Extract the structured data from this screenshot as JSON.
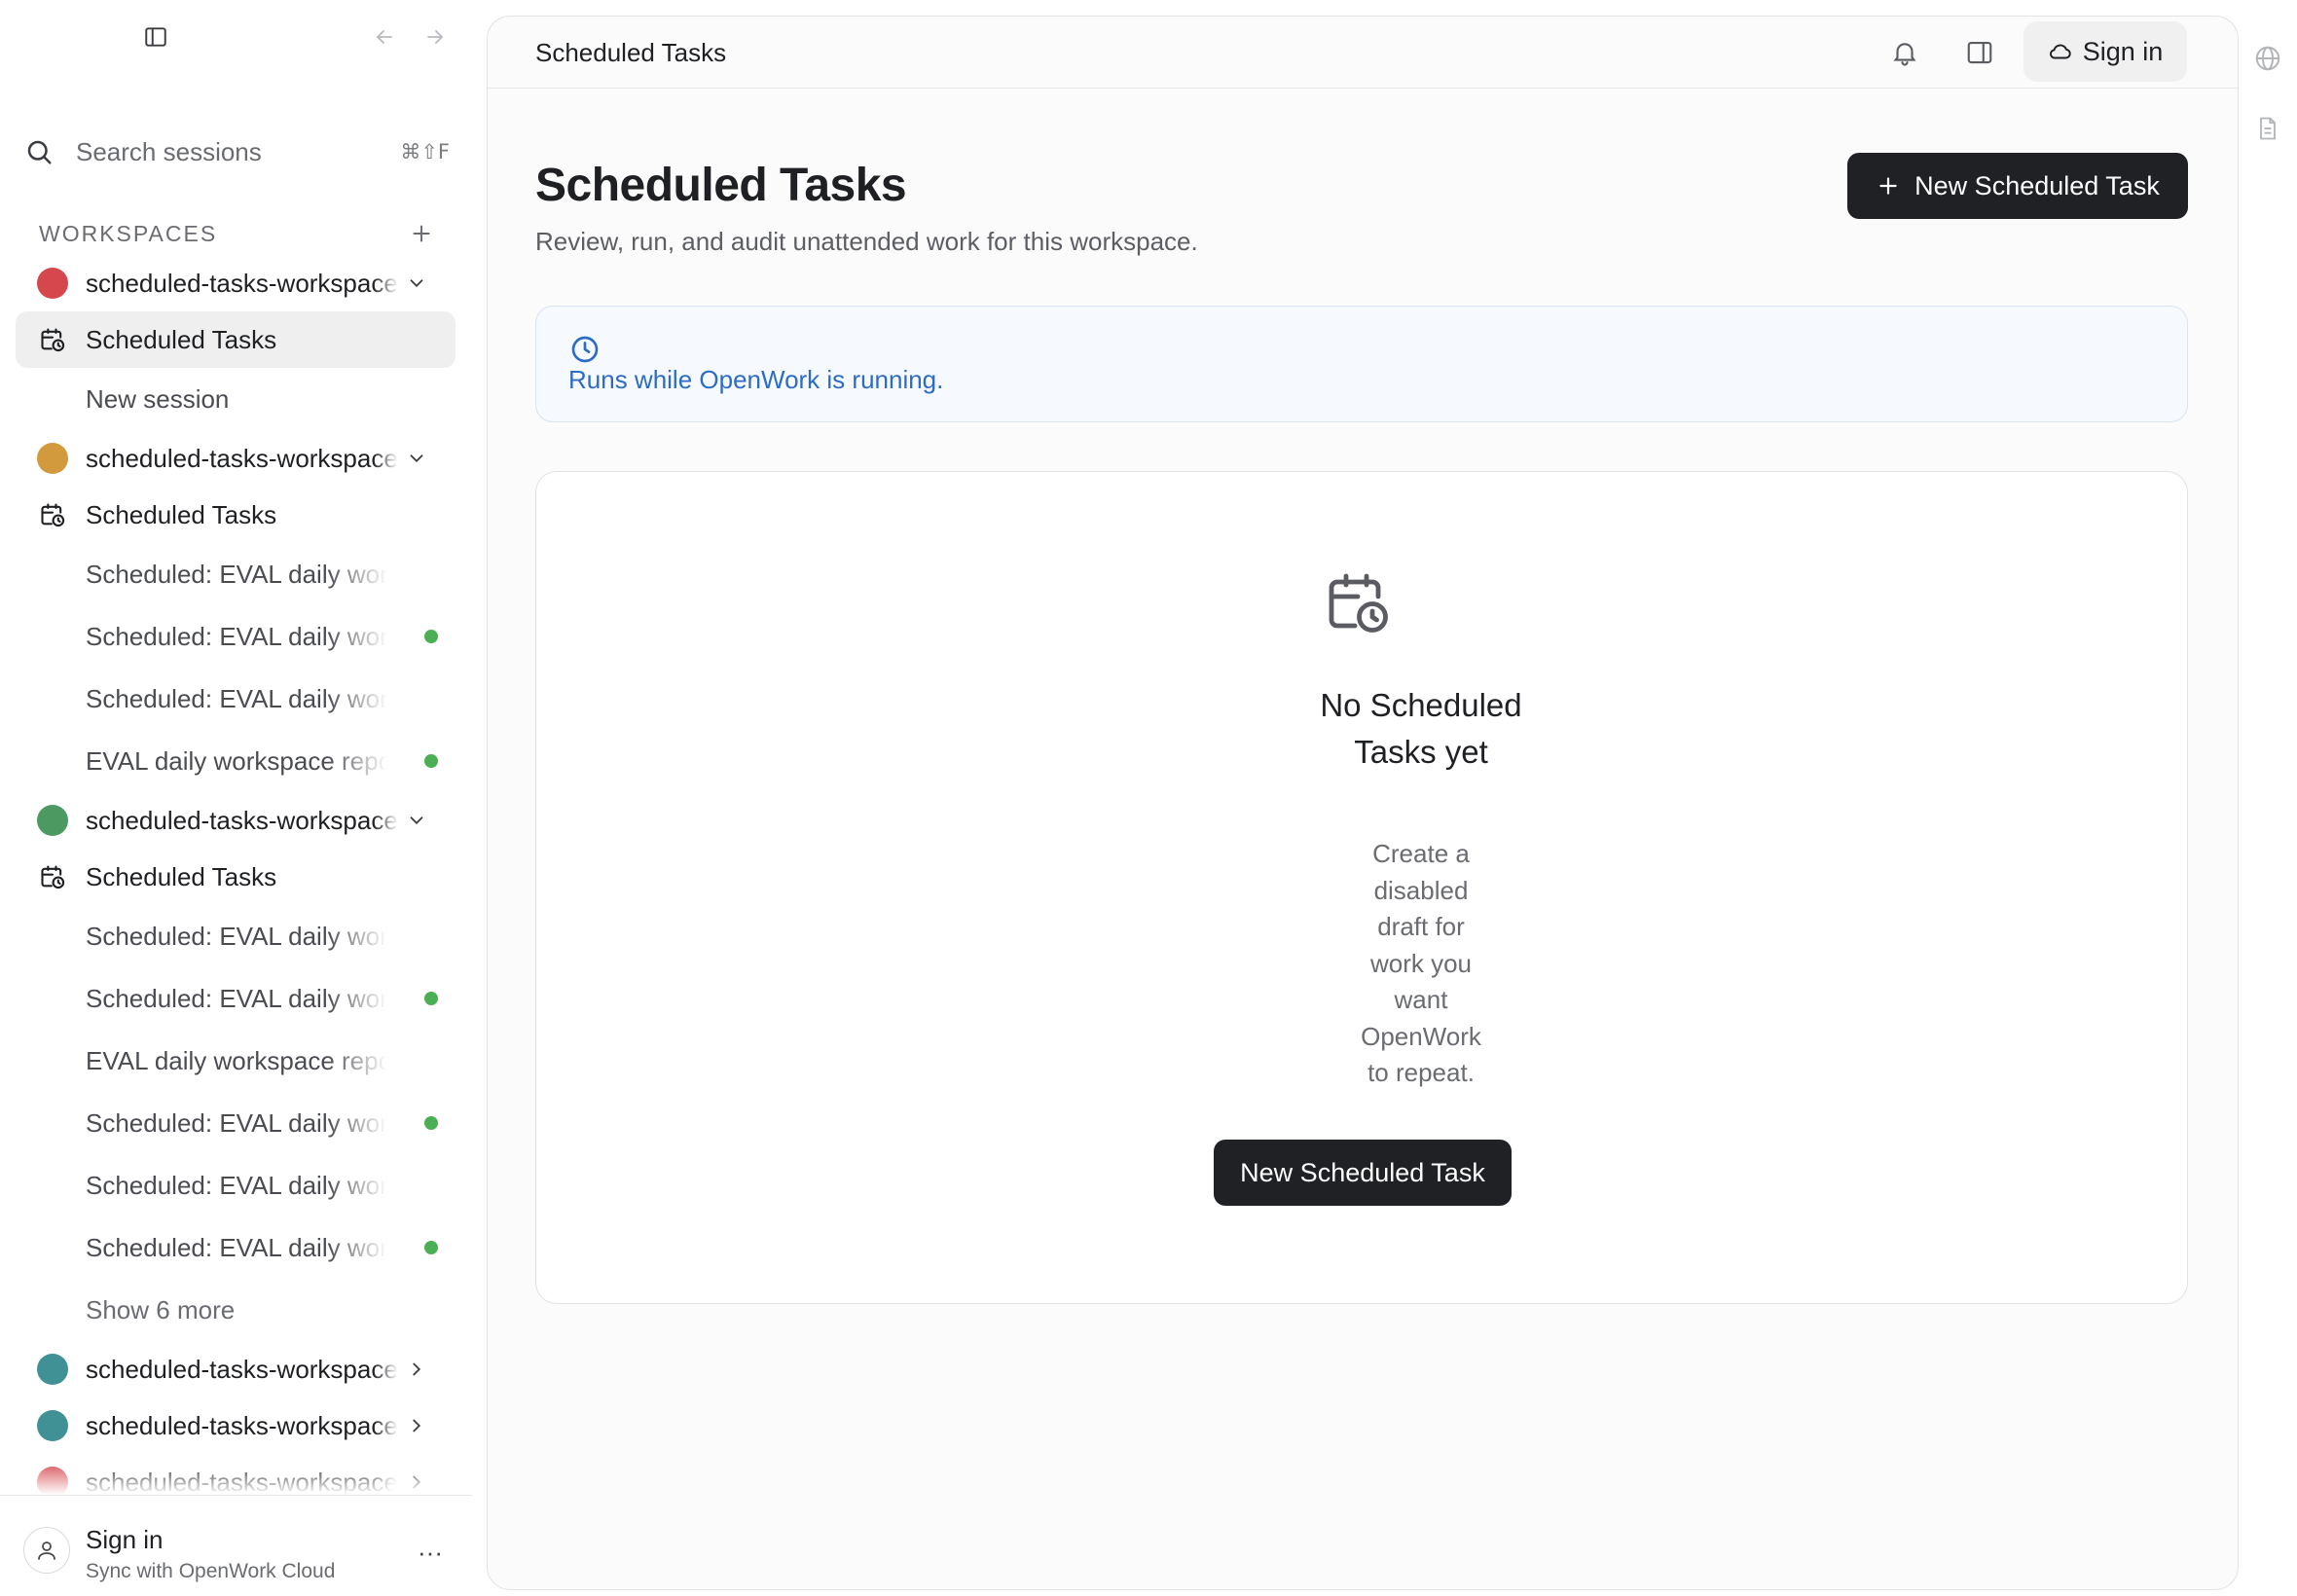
{
  "colors": {
    "primary_button": "#1f2125",
    "info_text": "#2d6cc4",
    "status_dot": "#4caf55",
    "workspace_red": "#d6474d",
    "workspace_orange": "#d39a3d",
    "workspace_green": "#4c9a62",
    "workspace_teal": "#3f9196"
  },
  "sidebar": {
    "search": {
      "label": "Search sessions",
      "shortcut": "⌘⇧F"
    },
    "workspaces_header": "WORKSPACES",
    "groups": [
      {
        "workspace": "scheduled-tasks-workspace",
        "color": "red",
        "expanded": true,
        "scheduled": "Scheduled Tasks",
        "sessions": [
          {
            "label": "New session",
            "status": false
          }
        ]
      },
      {
        "workspace": "scheduled-tasks-workspace",
        "color": "orange",
        "expanded": true,
        "scheduled": "Scheduled Tasks",
        "sessions": [
          {
            "label": "Scheduled: EVAL daily workspace report",
            "status": false
          },
          {
            "label": "Scheduled: EVAL daily workspace report",
            "status": true
          },
          {
            "label": "Scheduled: EVAL daily workspace report",
            "status": false
          },
          {
            "label": "EVAL daily workspace report",
            "status": true
          }
        ]
      },
      {
        "workspace": "scheduled-tasks-workspace",
        "color": "green",
        "expanded": true,
        "scheduled": "Scheduled Tasks",
        "sessions": [
          {
            "label": "Scheduled: EVAL daily workspace report",
            "status": false
          },
          {
            "label": "Scheduled: EVAL daily workspace report",
            "status": true
          },
          {
            "label": "EVAL daily workspace report",
            "status": false
          },
          {
            "label": "Scheduled: EVAL daily workspace report",
            "status": true
          },
          {
            "label": "Scheduled: EVAL daily workspace report",
            "status": false
          },
          {
            "label": "Scheduled: EVAL daily workspace report",
            "status": true
          }
        ],
        "show_more": "Show 6 more"
      }
    ],
    "collapsed_workspaces": [
      {
        "workspace": "scheduled-tasks-workspace",
        "color": "teal"
      },
      {
        "workspace": "scheduled-tasks-workspace",
        "color": "teal"
      },
      {
        "workspace": "scheduled-tasks-workspace",
        "color": "red"
      }
    ],
    "footer": {
      "name": "Sign in",
      "sub": "Sync with OpenWork Cloud",
      "menu": "···"
    }
  },
  "topbar": {
    "title": "Scheduled Tasks",
    "signin": "Sign in"
  },
  "page": {
    "title": "Scheduled Tasks",
    "subtitle": "Review, run, and audit unattended work for this workspace.",
    "new_button": "New Scheduled Task",
    "info": "Runs while OpenWork is running.",
    "empty": {
      "title": "No Scheduled Tasks yet",
      "description": "Create a disabled draft for work you want OpenWork to repeat.",
      "button": "New Scheduled Task"
    }
  },
  "icons": {
    "sidebar_toggle": "sidebar-toggle-icon",
    "back": "arrow-left-icon",
    "forward": "arrow-right-icon",
    "search": "search-icon",
    "plus": "plus-icon",
    "calendar_clock": "calendar-clock-icon",
    "chevron_down": "chevron-down-icon",
    "chevron_right": "chevron-right-icon",
    "bell": "bell-icon",
    "panel": "panel-right-icon",
    "cloud": "cloud-icon",
    "clock": "clock-icon",
    "globe": "globe-icon",
    "document": "document-icon",
    "user": "user-icon"
  }
}
